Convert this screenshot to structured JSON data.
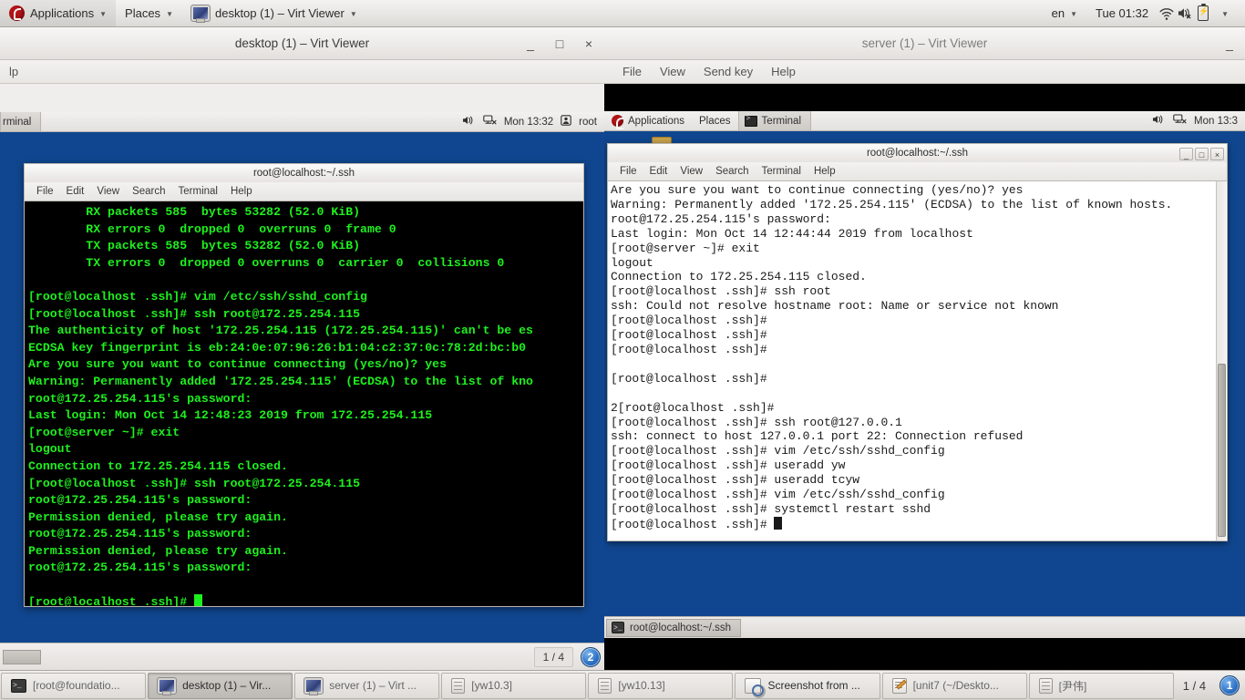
{
  "host_panel": {
    "applications_label": "Applications",
    "places_label": "Places",
    "active_window_label": "desktop (1) – Virt Viewer",
    "keyboard_layout": "en",
    "clock": "Tue 01:32",
    "icons": [
      "fedora-logo",
      "wifi-icon",
      "volume-muted-icon",
      "battery-icon",
      "chevron-down-icon"
    ]
  },
  "left_viewer": {
    "title": "desktop (1) – Virt Viewer",
    "window_buttons": {
      "minimize": "_",
      "maximize": "□",
      "close": "×"
    },
    "clipped_menu_text": "lp",
    "guest_panel": {
      "task_label": "rminal",
      "clock": "Mon 13:32",
      "user": "root",
      "icons": [
        "volume-icon",
        "network-icon",
        "user-icon"
      ]
    },
    "terminal": {
      "title": "root@localhost:~/.ssh",
      "menus": [
        "File",
        "Edit",
        "View",
        "Search",
        "Terminal",
        "Help"
      ],
      "lines": [
        "        RX packets 585  bytes 53282 (52.0 KiB)",
        "        RX errors 0  dropped 0  overruns 0  frame 0",
        "        TX packets 585  bytes 53282 (52.0 KiB)",
        "        TX errors 0  dropped 0 overruns 0  carrier 0  collisions 0",
        "",
        "[root@localhost .ssh]# vim /etc/ssh/sshd_config",
        "[root@localhost .ssh]# ssh root@172.25.254.115",
        "The authenticity of host '172.25.254.115 (172.25.254.115)' can't be es",
        "ECDSA key fingerprint is eb:24:0e:07:96:26:b1:04:c2:37:0c:78:2d:bc:b0",
        "Are you sure you want to continue connecting (yes/no)? yes",
        "Warning: Permanently added '172.25.254.115' (ECDSA) to the list of kno",
        "root@172.25.254.115's password:",
        "Last login: Mon Oct 14 12:48:23 2019 from 172.25.254.115",
        "[root@server ~]# exit",
        "logout",
        "Connection to 172.25.254.115 closed.",
        "[root@localhost .ssh]# ssh root@172.25.254.115",
        "root@172.25.254.115's password:",
        "Permission denied, please try again.",
        "root@172.25.254.115's password:",
        "Permission denied, please try again.",
        "root@172.25.254.115's password:",
        "",
        "[root@localhost .ssh]# "
      ]
    },
    "statusbar": {
      "page_count": "1 / 4",
      "badge": "2"
    }
  },
  "right_viewer": {
    "title": "server (1) – Virt Viewer",
    "menus": [
      "File",
      "View",
      "Send key",
      "Help"
    ],
    "window_buttons": {
      "minimize": "_"
    },
    "guest_panel": {
      "applications_label": "Applications",
      "places_label": "Places",
      "task_label": "Terminal",
      "clock": "Mon 13:3",
      "icons": [
        "volume-icon",
        "network-icon"
      ]
    },
    "terminal": {
      "title": "root@localhost:~/.ssh",
      "menus": [
        "File",
        "Edit",
        "View",
        "Search",
        "Terminal",
        "Help"
      ],
      "window_buttons": {
        "minimize": "_",
        "maximize": "□",
        "close": "×"
      },
      "lines": [
        "Are you sure you want to continue connecting (yes/no)? yes",
        "Warning: Permanently added '172.25.254.115' (ECDSA) to the list of known hosts.",
        "root@172.25.254.115's password:",
        "Last login: Mon Oct 14 12:44:44 2019 from localhost",
        "[root@server ~]# exit",
        "logout",
        "Connection to 172.25.254.115 closed.",
        "[root@localhost .ssh]# ssh root",
        "ssh: Could not resolve hostname root: Name or service not known",
        "[root@localhost .ssh]#",
        "[root@localhost .ssh]#",
        "[root@localhost .ssh]#",
        "",
        "[root@localhost .ssh]#",
        "",
        "2[root@localhost .ssh]#",
        "[root@localhost .ssh]# ssh root@127.0.0.1",
        "ssh: connect to host 127.0.0.1 port 22: Connection refused",
        "[root@localhost .ssh]# vim /etc/ssh/sshd_config",
        "[root@localhost .ssh]# useradd yw",
        "[root@localhost .ssh]# useradd tcyw",
        "[root@localhost .ssh]# vim /etc/ssh/sshd_config",
        "[root@localhost .ssh]# systemctl restart sshd",
        "[root@localhost .ssh]# "
      ]
    },
    "guest_taskbar": {
      "task_label": "root@localhost:~/.ssh"
    }
  },
  "host_taskbar": {
    "tasks": [
      {
        "label": "[root@foundatio...",
        "icon": "terminal-icon",
        "active": false
      },
      {
        "label": "desktop (1) – Vir...",
        "icon": "virt-viewer-icon",
        "active": true
      },
      {
        "label": "server (1) – Virt ...",
        "icon": "virt-viewer-icon",
        "active": false
      },
      {
        "label": "[yw10.3]",
        "icon": "archive-icon",
        "active": false
      },
      {
        "label": "[yw10.13]",
        "icon": "archive-icon",
        "active": false
      },
      {
        "label": "Screenshot from ...",
        "icon": "screenshot-icon",
        "active": false
      },
      {
        "label": "[unit7 (~/Deskto...",
        "icon": "text-editor-icon",
        "active": false
      },
      {
        "label": "[尹伟]",
        "icon": "archive-icon",
        "active": false
      }
    ],
    "page_count": "1 / 4",
    "badge": "1"
  }
}
